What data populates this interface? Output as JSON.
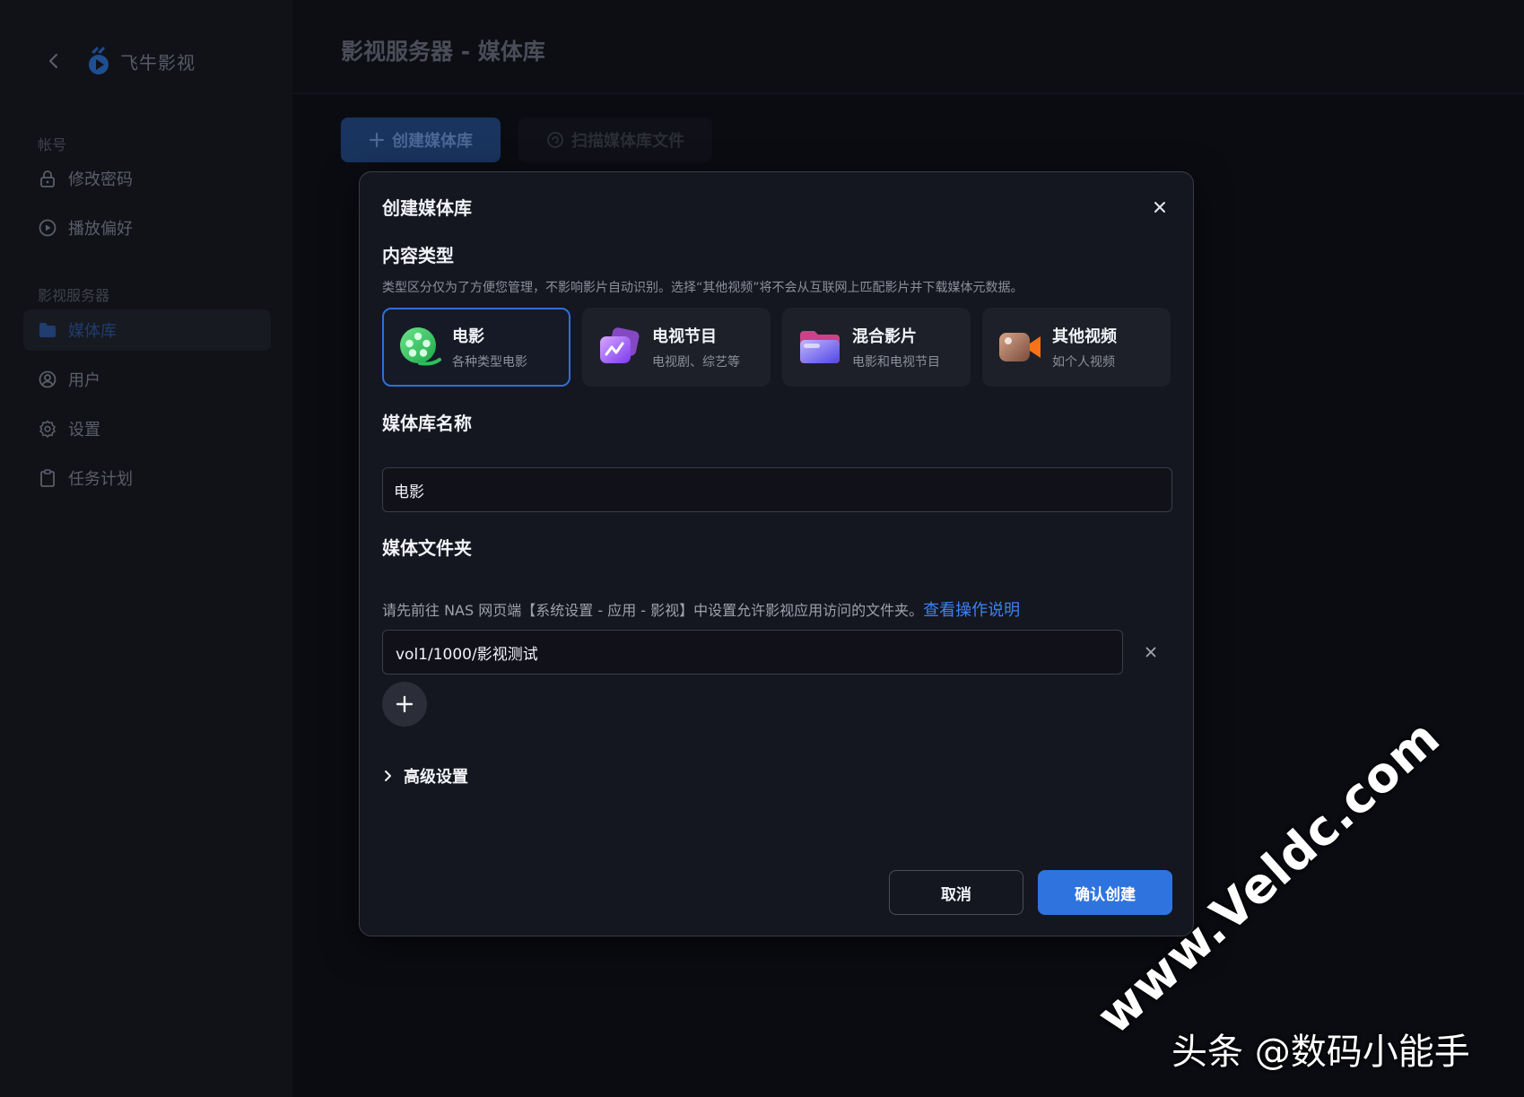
{
  "app": {
    "brand_name": "飞牛影视",
    "page_title": "影视服务器 - 媒体库"
  },
  "sidebar": {
    "sections": [
      {
        "label": "帐号",
        "items": [
          {
            "label": "修改密码",
            "icon": "lock-icon"
          },
          {
            "label": "播放偏好",
            "icon": "play-circle-icon"
          }
        ]
      },
      {
        "label": "影视服务器",
        "items": [
          {
            "label": "媒体库",
            "icon": "folder-icon",
            "active": true
          },
          {
            "label": "用户",
            "icon": "user-icon"
          },
          {
            "label": "设置",
            "icon": "gear-icon"
          },
          {
            "label": "任务计划",
            "icon": "clipboard-icon"
          }
        ]
      }
    ]
  },
  "toolbar": {
    "create_label": "创建媒体库",
    "scan_label": "扫描媒体库文件"
  },
  "modal": {
    "title": "创建媒体库",
    "content_type": {
      "label": "内容类型",
      "hint": "类型区分仅为了方便您管理，不影响影片自动识别。选择“其他视频”将不会从互联网上匹配影片并下载媒体元数据。",
      "options": [
        {
          "name": "电影",
          "desc": "各种类型电影",
          "icon": "film-reel-icon",
          "selected": true
        },
        {
          "name": "电视节目",
          "desc": "电视剧、综艺等",
          "icon": "tv-icon",
          "selected": false
        },
        {
          "name": "混合影片",
          "desc": "电影和电视节目",
          "icon": "mixed-folder-icon",
          "selected": false
        },
        {
          "name": "其他视频",
          "desc": "如个人视频",
          "icon": "camera-icon",
          "selected": false
        }
      ]
    },
    "library_name": {
      "label": "媒体库名称",
      "value": "电影"
    },
    "media_folder": {
      "label": "媒体文件夹",
      "hint": "请先前往 NAS 网页端【系统设置 - 应用 - 影视】中设置允许影视应用访问的文件夹。",
      "link": "查看操作说明",
      "folders": [
        "vol1/1000/影视测试"
      ]
    },
    "advanced_label": "高级设置",
    "cancel_label": "取消",
    "confirm_label": "确认创建"
  },
  "watermark": {
    "site": "www.Veldc.com",
    "author": "头条 @数码小能手"
  },
  "colors": {
    "accent": "#2f74de",
    "background": "#0b0c12",
    "modal": "#141620",
    "link": "#3b82f6"
  }
}
